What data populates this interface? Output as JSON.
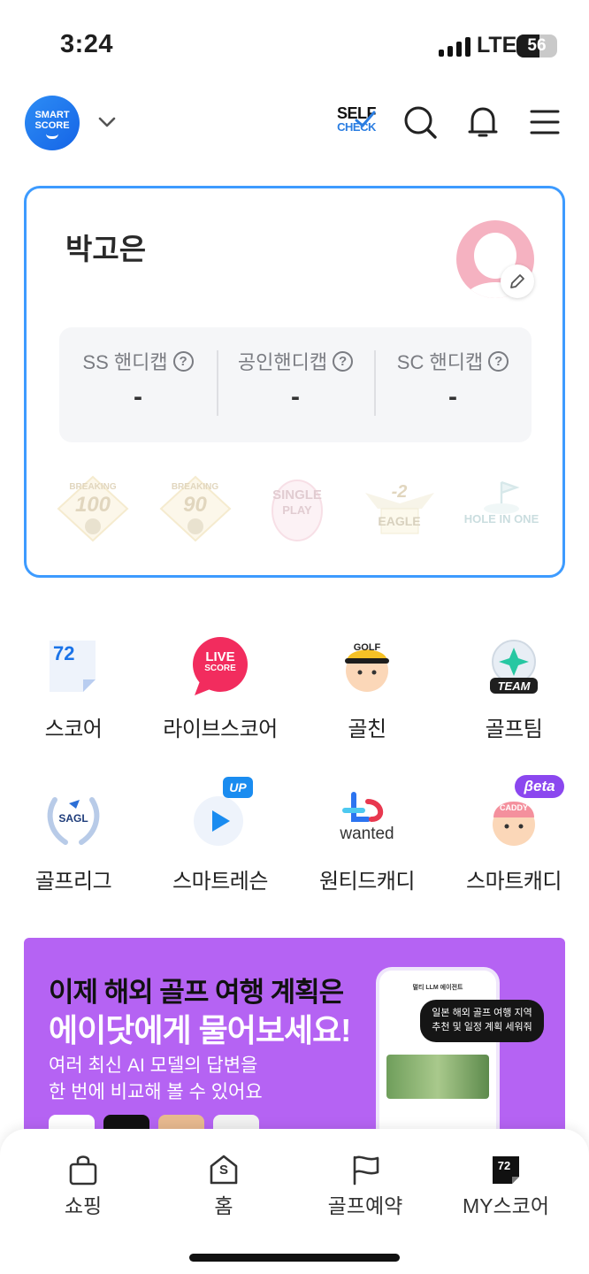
{
  "status_bar": {
    "time": "3:24",
    "network": "LTE",
    "battery": "56",
    "battery_level": 0.56
  },
  "header": {
    "logo_line1": "SMART",
    "logo_line2": "SCORE",
    "self_check_line1": "SELF",
    "self_check_line2": "CHECK"
  },
  "profile": {
    "name": "박고은",
    "handicaps": [
      {
        "label": "SS 핸디캡",
        "value": "-"
      },
      {
        "label": "공인핸디캡",
        "value": "-"
      },
      {
        "label": "SC 핸디캡",
        "value": "-"
      }
    ],
    "badges": [
      {
        "line1": "BREAKING",
        "line2": "100"
      },
      {
        "line1": "BREAKING",
        "line2": "90"
      },
      {
        "line1": "SINGLE",
        "line2": "PLAY"
      },
      {
        "line1": "-2",
        "line2": "EAGLE"
      },
      {
        "line1": "",
        "line2": "HOLE IN ONE"
      }
    ]
  },
  "menu": {
    "row1": [
      {
        "label": "스코어",
        "icon_text": "72"
      },
      {
        "label": "라이브스코어",
        "icon_text1": "LIVE",
        "icon_text2": "SCORE"
      },
      {
        "label": "골친",
        "icon_text": "GOLF"
      },
      {
        "label": "골프팀",
        "icon_text": "TEAM"
      }
    ],
    "row2": [
      {
        "label": "골프리그",
        "icon_text": "SAGL"
      },
      {
        "label": "스마트레슨",
        "badge": "UP"
      },
      {
        "label": "원티드캐디",
        "icon_text": "wanted"
      },
      {
        "label": "스마트캐디",
        "badge": "βeta",
        "icon_text": "CADDY"
      }
    ]
  },
  "banner": {
    "line1": "이제 해외 골프 여행 계획은",
    "line2": "에이닷에게 물어보세요!",
    "line3": "여러 최신 AI 모델의 답변을",
    "line4": "한 번에 비교해 볼 수 있어요",
    "phone_title": "멀티 LLM 에이전트",
    "bubble_line1": "일본 해외 골프 여행 지역",
    "bubble_line2": "추천 및 일정 계획 세워줘"
  },
  "bottom_nav": [
    {
      "label": "쇼핑"
    },
    {
      "label": "홈",
      "icon_text": "S"
    },
    {
      "label": "골프예약"
    },
    {
      "label": "MY스코어",
      "icon_text": "72"
    }
  ]
}
